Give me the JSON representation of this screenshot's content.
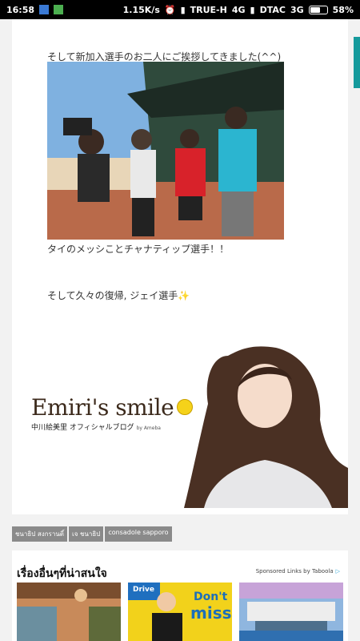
{
  "status_bar": {
    "time": "16:58",
    "net_speed": "1.15K/s",
    "carrier1": "TRUE-H",
    "net1": "4G",
    "carrier2": "DTAC",
    "net2": "3G",
    "battery": "58%",
    "battery_level": 0.58
  },
  "post": {
    "line1": "そして新加入選手のお二人にご挨拶してきました(^^)",
    "caption": "タイのメッシことチャナティップ選手！！",
    "line2": "そして久々の復帰, ジェイ選手✨"
  },
  "banner": {
    "title": "Emiri's smile",
    "subtitle": "中川絵美里 オフィシャルブログ",
    "by": "by Ameba"
  },
  "tags": [
    "ชนาธิป สงกรานติ์",
    "เจ ชนาธิป",
    "consadole sapporo"
  ],
  "sponsored": {
    "heading": "เรื่องอื่นๆที่น่าสนใจ",
    "by_text": "Sponsored Links by Taboola",
    "ad2_text1": "Drive",
    "ad2_text2": "Don't",
    "ad2_text3": "miss"
  },
  "colors": {
    "accent": "#159a9c",
    "tag_bg": "#8a8a8a"
  }
}
